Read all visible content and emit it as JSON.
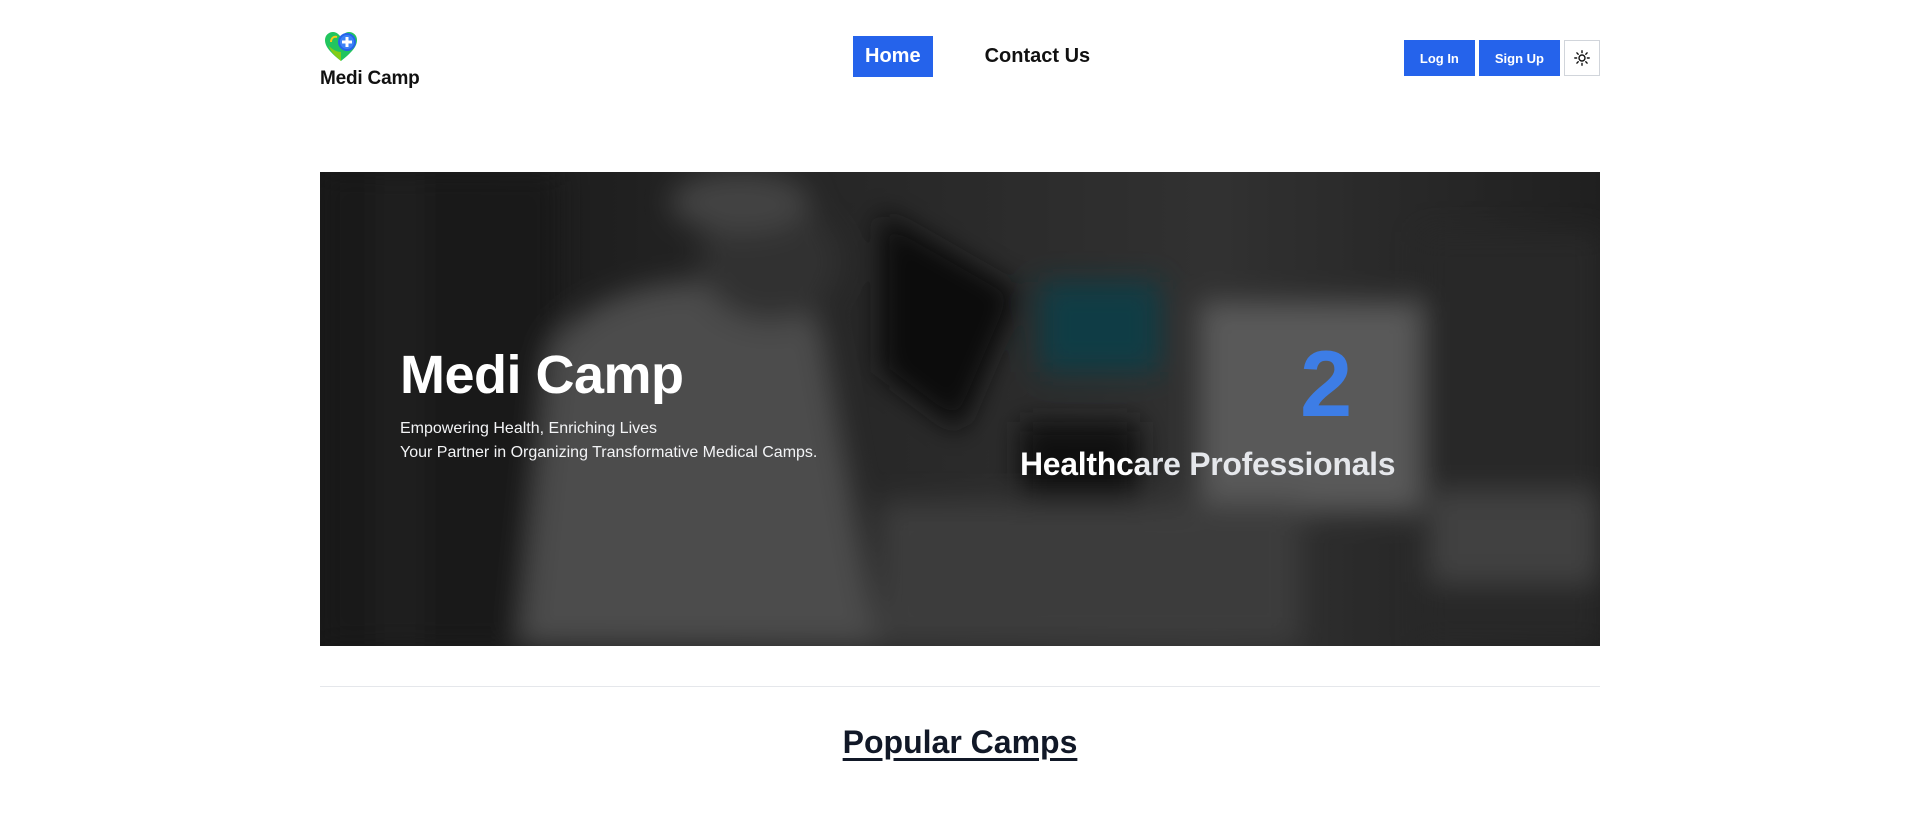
{
  "brand": {
    "name": "Medi Camp",
    "logo_icon": "heart-plus-icon"
  },
  "nav": {
    "links": [
      {
        "label": "Home",
        "active": true
      },
      {
        "label": "Contact Us",
        "active": false
      }
    ]
  },
  "auth": {
    "login_label": "Log In",
    "signup_label": "Sign Up",
    "theme_icon": "sun-icon"
  },
  "hero": {
    "title": "Medi Camp",
    "tagline_line1": "Empowering Health, Enriching Lives",
    "tagline_line2": "Your Partner in Organizing Transformative Medical Camps.",
    "stat_number": "2",
    "stat_label": "Healthcare Professionals"
  },
  "sections": {
    "popular_title": "Popular Camps"
  },
  "colors": {
    "accent": "#2563eb",
    "stat": "#3b82f6"
  }
}
